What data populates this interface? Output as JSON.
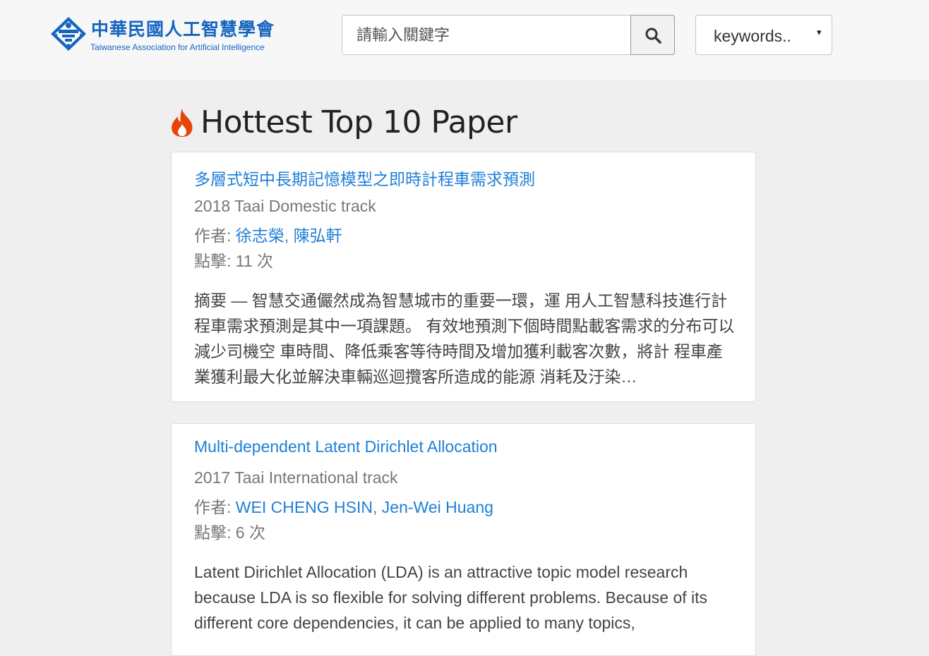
{
  "header": {
    "logo_cn": "中華民國人工智慧學會",
    "logo_en": "Taiwanese Association for Artificial Intelligence",
    "search_placeholder": "請輸入關鍵字",
    "search_icon": "search-icon",
    "select_value": "keywords..",
    "select_caret": "▾"
  },
  "section": {
    "title": "Hottest Top 10 Paper",
    "icon": "fire-icon",
    "icon_color": "#e8440a"
  },
  "papers": [
    {
      "title": "多層式短中長期記憶模型之即時計程車需求預測",
      "meta": "2018 Taai Domestic track",
      "authors_label": "作者: ",
      "authors": [
        "徐志榮",
        "陳弘軒"
      ],
      "authors_sep": ", ",
      "clicks": "點擊: 11 次",
      "abstract": "摘要 — 智慧交通儼然成為智慧城市的重要一環，運 用人工智慧科技進行計程車需求預測是其中一項課題。 有效地預測下個時間點載客需求的分布可以減少司機空 車時間、降低乘客等待時間及增加獲利載客次數，將計 程車產業獲利最大化並解決車輛巡迴攬客所造成的能源 消耗及汙染…"
    },
    {
      "title": "Multi-dependent Latent Dirichlet Allocation",
      "meta": "2017 Taai International track",
      "authors_label": "作者: ",
      "authors": [
        "WEI CHENG HSIN",
        "Jen-Wei Huang"
      ],
      "authors_sep": ", ",
      "clicks": "點擊: 6 次",
      "abstract": "Latent Dirichlet Allocation (LDA) is an attractive topic model research because LDA is so flexible for solving different problems. Because of its different core dependencies, it can be applied to many topics,"
    }
  ],
  "colors": {
    "link": "#1f7fd6",
    "brand": "#1565c0",
    "muted": "#777777"
  }
}
